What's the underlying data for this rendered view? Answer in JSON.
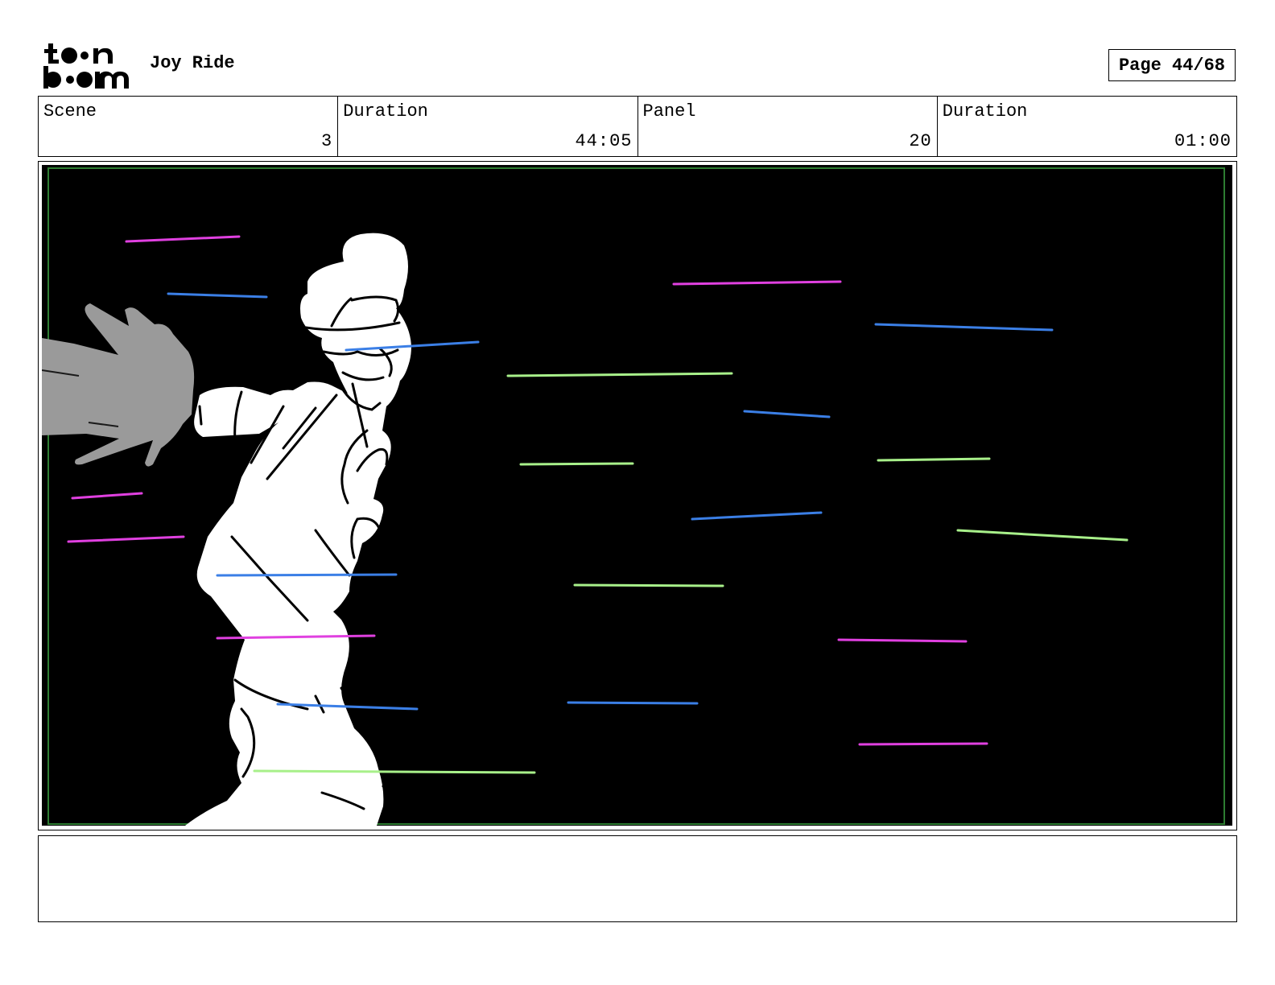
{
  "header": {
    "logo_text": "toon boom",
    "project_title": "Joy Ride",
    "page_indicator": "Page 44/68"
  },
  "info": {
    "scene_label": "Scene",
    "scene_value": "3",
    "scene_duration_label": "Duration",
    "scene_duration_value": "44:05",
    "panel_label": "Panel",
    "panel_value": "20",
    "panel_duration_label": "Duration",
    "panel_duration_value": "01:00"
  },
  "panel": {
    "background_color": "#000000",
    "safe_frame_color": "#2e7d32",
    "streak_colors": {
      "magenta": "#e040e0",
      "blue": "#3b7fe6",
      "green": "#a8f08a"
    }
  },
  "notes": {}
}
